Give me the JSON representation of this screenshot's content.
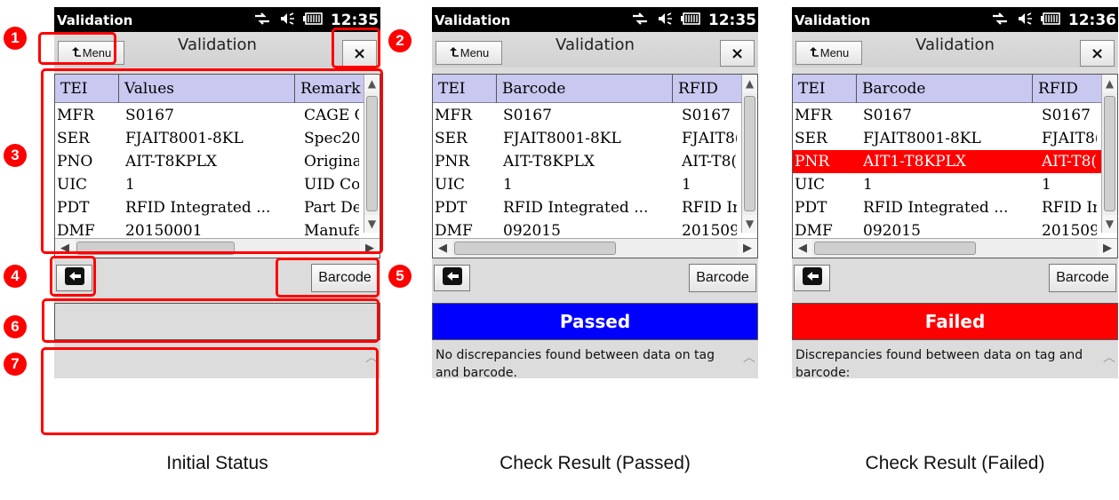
{
  "screens": [
    {
      "status_app": "Validation",
      "clock": "12:35",
      "title": "Validation",
      "menu_label": "Menu",
      "close_label": "×",
      "columns": [
        "TEI",
        "Values",
        "Remark"
      ],
      "rows": [
        [
          "MFR",
          "S0167",
          "CAGE C"
        ],
        [
          "SER",
          "FJAIT8001-8KL",
          "Spec20"
        ],
        [
          "PNO",
          "AIT-T8KPLX",
          "Origina"
        ],
        [
          "UIC",
          "1",
          "UID Co"
        ],
        [
          "PDT",
          "RFID Integrated ...",
          "Part De"
        ],
        [
          "DMF",
          "20150001",
          "Manufa"
        ]
      ],
      "barcode_label": "Barcode",
      "status_text": "",
      "status_state": "empty",
      "message": "",
      "caption": "Initial Status"
    },
    {
      "status_app": "Validation",
      "clock": "12:35",
      "title": "Validation",
      "menu_label": "Menu",
      "close_label": "×",
      "columns": [
        "TEI",
        "Barcode",
        "RFID"
      ],
      "rows": [
        [
          "MFR",
          "S0167",
          "S0167"
        ],
        [
          "SER",
          "FJAIT8001-8KL",
          "FJAIT8("
        ],
        [
          "PNR",
          "AIT-T8KPLX",
          "AIT-T8("
        ],
        [
          "UIC",
          "1",
          "1"
        ],
        [
          "PDT",
          "RFID Integrated ...",
          "RFID In"
        ],
        [
          "DMF",
          "092015",
          "201509"
        ]
      ],
      "barcode_label": "Barcode",
      "status_text": "Passed",
      "status_state": "passed",
      "message": "No discrepancies found between data on tag and barcode.",
      "caption": "Check Result (Passed)"
    },
    {
      "status_app": "Validation",
      "clock": "12:36",
      "title": "Validation",
      "menu_label": "Menu",
      "close_label": "×",
      "columns": [
        "TEI",
        "Barcode",
        "RFID"
      ],
      "rows": [
        [
          "MFR",
          "S0167",
          "S0167"
        ],
        [
          "SER",
          "FJAIT8001-8KL",
          "FJAIT8("
        ],
        [
          "PNR",
          "AIT1-T8KPLX",
          "AIT-T8("
        ],
        [
          "UIC",
          "1",
          "1"
        ],
        [
          "PDT",
          "RFID Integrated ...",
          "RFID In"
        ],
        [
          "DMF",
          "092015",
          "201509"
        ]
      ],
      "failed_row": 2,
      "barcode_label": "Barcode",
      "status_text": "Failed",
      "status_state": "failed",
      "message": "Discrepancies found between data on tag and barcode:\nValue of TEI",
      "caption": "Check Result (Failed)"
    }
  ],
  "callouts": [
    "1",
    "2",
    "3",
    "4",
    "5",
    "6",
    "7"
  ],
  "colors": {
    "status_bar": "#000000",
    "table_header": "#c8c8f0",
    "passed": "#0000ff",
    "failed": "#ff0000",
    "annotation": "#ff0000",
    "panel": "#dcdcdc"
  },
  "icons": [
    "menu-up-arrow-icon",
    "close-icon",
    "back-arrow-icon",
    "signal-arrows-icon",
    "speaker-icon",
    "battery-icon"
  ]
}
